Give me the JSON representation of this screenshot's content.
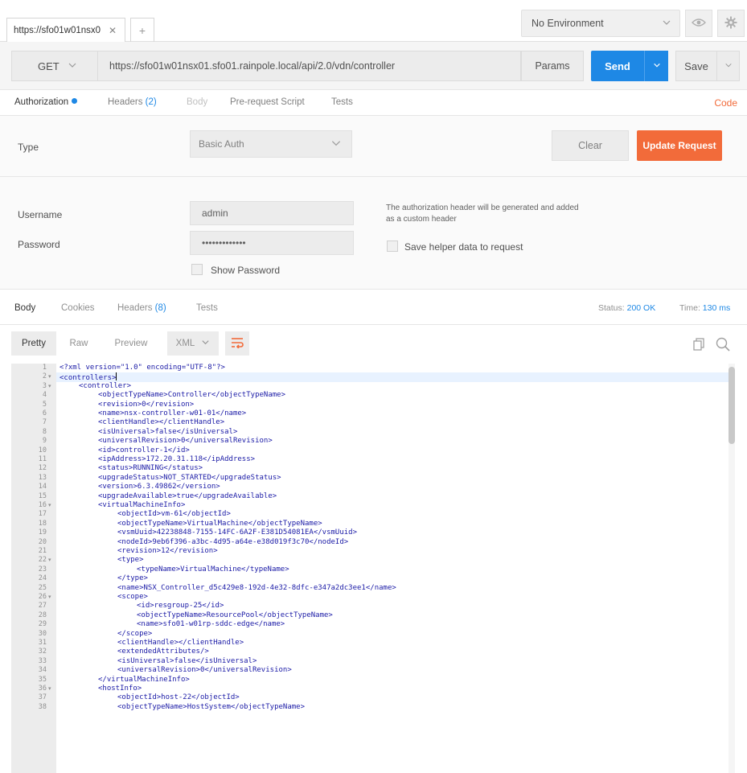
{
  "tabs": {
    "request_tab_title": "https://sfo01w01nsx0",
    "close_glyph": "✕",
    "new_tab_glyph": "+"
  },
  "environment": {
    "selected": "No Environment"
  },
  "request": {
    "method": "GET",
    "url": "https://sfo01w01nsx01.sfo01.rainpole.local/api/2.0/vdn/controller",
    "params_label": "Params",
    "send_label": "Send",
    "save_label": "Save"
  },
  "request_tabs": {
    "authorization": "Authorization",
    "headers": "Headers",
    "headers_count": "(2)",
    "body": "Body",
    "prerequest": "Pre-request Script",
    "tests": "Tests",
    "code": "Code"
  },
  "auth": {
    "type_label": "Type",
    "type_value": "Basic Auth",
    "clear_label": "Clear",
    "update_label": "Update Request",
    "username_label": "Username",
    "username_value": "admin",
    "password_label": "Password",
    "password_value": "•••••••••••••",
    "show_password_label": "Show Password",
    "hint": "The authorization header will be generated and added as a custom header",
    "save_helper_label": "Save helper data to request"
  },
  "response": {
    "tabs": {
      "body": "Body",
      "cookies": "Cookies",
      "headers": "Headers",
      "headers_count": "(8)",
      "tests": "Tests"
    },
    "status_label": "Status:",
    "status_value": "200 OK",
    "time_label": "Time:",
    "time_value": "130 ms",
    "view_modes": {
      "pretty": "Pretty",
      "raw": "Raw",
      "preview": "Preview",
      "format": "XML"
    }
  },
  "code_lines": [
    {
      "n": "1",
      "fold": false,
      "indent": 0,
      "text": "<?xml version=\"1.0\" encoding=\"UTF-8\"?>"
    },
    {
      "n": "2",
      "fold": true,
      "indent": 0,
      "text": "<controllers>"
    },
    {
      "n": "3",
      "fold": true,
      "indent": 1,
      "text": "<controller>"
    },
    {
      "n": "4",
      "fold": false,
      "indent": 2,
      "text": "<objectTypeName>Controller</objectTypeName>"
    },
    {
      "n": "5",
      "fold": false,
      "indent": 2,
      "text": "<revision>0</revision>"
    },
    {
      "n": "6",
      "fold": false,
      "indent": 2,
      "text": "<name>nsx-controller-w01-01</name>"
    },
    {
      "n": "7",
      "fold": false,
      "indent": 2,
      "text": "<clientHandle></clientHandle>"
    },
    {
      "n": "8",
      "fold": false,
      "indent": 2,
      "text": "<isUniversal>false</isUniversal>"
    },
    {
      "n": "9",
      "fold": false,
      "indent": 2,
      "text": "<universalRevision>0</universalRevision>"
    },
    {
      "n": "10",
      "fold": false,
      "indent": 2,
      "text": "<id>controller-1</id>"
    },
    {
      "n": "11",
      "fold": false,
      "indent": 2,
      "text": "<ipAddress>172.20.31.118</ipAddress>"
    },
    {
      "n": "12",
      "fold": false,
      "indent": 2,
      "text": "<status>RUNNING</status>"
    },
    {
      "n": "13",
      "fold": false,
      "indent": 2,
      "text": "<upgradeStatus>NOT_STARTED</upgradeStatus>"
    },
    {
      "n": "14",
      "fold": false,
      "indent": 2,
      "text": "<version>6.3.49862</version>"
    },
    {
      "n": "15",
      "fold": false,
      "indent": 2,
      "text": "<upgradeAvailable>true</upgradeAvailable>"
    },
    {
      "n": "16",
      "fold": true,
      "indent": 2,
      "text": "<virtualMachineInfo>"
    },
    {
      "n": "17",
      "fold": false,
      "indent": 3,
      "text": "<objectId>vm-61</objectId>"
    },
    {
      "n": "18",
      "fold": false,
      "indent": 3,
      "text": "<objectTypeName>VirtualMachine</objectTypeName>"
    },
    {
      "n": "19",
      "fold": false,
      "indent": 3,
      "text": "<vsmUuid>42238848-7155-14FC-6A2F-E381D54081EA</vsmUuid>"
    },
    {
      "n": "20",
      "fold": false,
      "indent": 3,
      "text": "<nodeId>9eb6f396-a3bc-4d95-a64e-e38d019f3c70</nodeId>"
    },
    {
      "n": "21",
      "fold": false,
      "indent": 3,
      "text": "<revision>12</revision>"
    },
    {
      "n": "22",
      "fold": true,
      "indent": 3,
      "text": "<type>"
    },
    {
      "n": "23",
      "fold": false,
      "indent": 4,
      "text": "<typeName>VirtualMachine</typeName>"
    },
    {
      "n": "24",
      "fold": false,
      "indent": 3,
      "text": "</type>"
    },
    {
      "n": "25",
      "fold": false,
      "indent": 3,
      "text": "<name>NSX_Controller_d5c429e8-192d-4e32-8dfc-e347a2dc3ee1</name>"
    },
    {
      "n": "26",
      "fold": true,
      "indent": 3,
      "text": "<scope>"
    },
    {
      "n": "27",
      "fold": false,
      "indent": 4,
      "text": "<id>resgroup-25</id>"
    },
    {
      "n": "28",
      "fold": false,
      "indent": 4,
      "text": "<objectTypeName>ResourcePool</objectTypeName>"
    },
    {
      "n": "29",
      "fold": false,
      "indent": 4,
      "text": "<name>sfo01-w01rp-sddc-edge</name>"
    },
    {
      "n": "30",
      "fold": false,
      "indent": 3,
      "text": "</scope>"
    },
    {
      "n": "31",
      "fold": false,
      "indent": 3,
      "text": "<clientHandle></clientHandle>"
    },
    {
      "n": "32",
      "fold": false,
      "indent": 3,
      "text": "<extendedAttributes/>"
    },
    {
      "n": "33",
      "fold": false,
      "indent": 3,
      "text": "<isUniversal>false</isUniversal>"
    },
    {
      "n": "34",
      "fold": false,
      "indent": 3,
      "text": "<universalRevision>0</universalRevision>"
    },
    {
      "n": "35",
      "fold": false,
      "indent": 2,
      "text": "</virtualMachineInfo>"
    },
    {
      "n": "36",
      "fold": true,
      "indent": 2,
      "text": "<hostInfo>"
    },
    {
      "n": "37",
      "fold": false,
      "indent": 3,
      "text": "<objectId>host-22</objectId>"
    },
    {
      "n": "38",
      "fold": false,
      "indent": 3,
      "text": "<objectTypeName>HostSystem</objectTypeName>"
    }
  ],
  "colors": {
    "accent": "#1e88e5",
    "update": "#f26b3a",
    "tag": "#1a1aa6"
  }
}
